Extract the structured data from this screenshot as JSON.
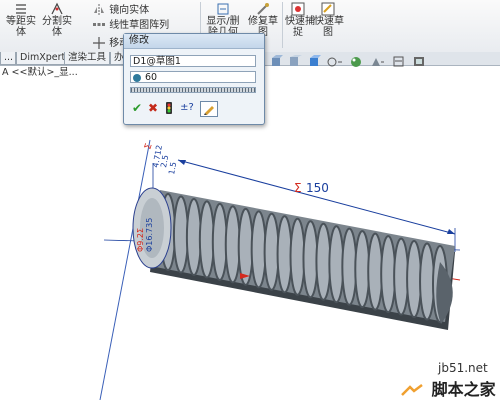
{
  "ribbon": {
    "equal_spacing": "等距实\n体",
    "split_entity": "分割实\n体",
    "mirror_entity": "镜向实体",
    "linear_pattern": "线性草图阵列",
    "move_entity": "移动",
    "show_delete_relations": "显示/删\n除几何",
    "repair_sketch": "修复草\n图",
    "quick_snap": "快速捕\n捉",
    "rapid_sketch": "快速草\n图"
  },
  "tabs": [
    {
      "label": "..."
    },
    {
      "label": "DimXpert"
    },
    {
      "label": "渲染工具"
    },
    {
      "label": "办"
    }
  ],
  "tree": {
    "path": "A <<默认>_显..."
  },
  "dialog": {
    "title": "修改",
    "dimension_name": "D1@草图1",
    "value": "60",
    "buttons": {
      "ok": "✔",
      "cancel": "✖",
      "rebuild": "",
      "reverse": "±?",
      "mark": ""
    }
  },
  "model": {
    "length_dim": "150",
    "sigma": "Σ",
    "vertical_dims": [
      "Σ",
      "4.712",
      "2.5",
      "1.5",
      "12.5"
    ],
    "diam_dims": [
      "Φ9.2Σ",
      "Φ16.735"
    ]
  },
  "watermark": {
    "site": "jb51.net",
    "brand": "脚本之家"
  },
  "colors": {
    "dimension_red": "#d42a1e",
    "dimension_blue": "#1a3f9e",
    "coil_dark": "#4a5259",
    "coil_light": "#a9b1b9"
  }
}
